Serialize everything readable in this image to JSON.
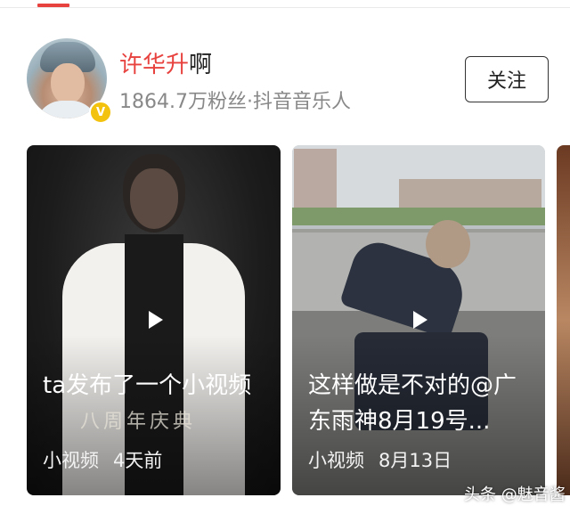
{
  "profile": {
    "name_primary": "许华升",
    "name_suffix": "啊",
    "followers_line": "1864.7万粉丝·抖音音乐人",
    "follow_label": "关注",
    "verified_mark": "V"
  },
  "videos": [
    {
      "title": "ta发布了一个小视频",
      "watermark_text": "八周年庆典",
      "type_label": "小视频",
      "time": "4天前"
    },
    {
      "title": "这样做是不对的@广东雨神8月19号...",
      "type_label": "小视频",
      "time": "8月13日"
    }
  ],
  "source_watermark": "头条 @魅音酱",
  "colors": {
    "accent": "#e8423f",
    "verified": "#f3c20f",
    "secondary_text": "#888888"
  },
  "icons": {
    "play": "play-icon",
    "verified": "verified-badge-icon"
  }
}
